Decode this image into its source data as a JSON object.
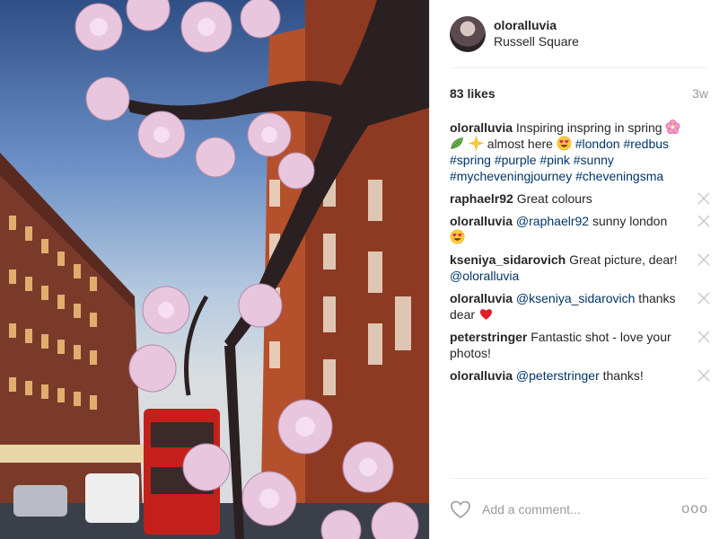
{
  "header": {
    "username": "oloralluvia",
    "location": "Russell Square"
  },
  "stats": {
    "likes": "83 likes",
    "time_ago": "3w"
  },
  "caption": {
    "author": "oloralluvia",
    "text1": " Inspiring inspring in spring ",
    "text2": " almost here ",
    "tags": [
      "#london",
      "#redbus",
      "#spring",
      "#purple",
      "#pink",
      "#sunny",
      "#mycheveningjourney",
      "#cheveningsma"
    ]
  },
  "comments": [
    {
      "author": "raphaelr92",
      "mention": "",
      "text": " Great colours"
    },
    {
      "author": "oloralluvia",
      "mention": "@raphaelr92",
      "text": " sunny london"
    },
    {
      "author": "kseniya_sidarovich",
      "mention": "",
      "text": " Great picture, dear! ",
      "trail_mention": "@oloralluvia"
    },
    {
      "author": "oloralluvia",
      "mention": "@kseniya_sidarovich",
      "text": " thanks dear "
    },
    {
      "author": "peterstringer",
      "mention": "",
      "text": " Fantastic shot - love your photos!"
    },
    {
      "author": "oloralluvia",
      "mention": "@peterstringer",
      "text": " thanks!"
    }
  ],
  "footer": {
    "add_comment_placeholder": "Add a comment...",
    "more_label": "ooo"
  },
  "icons": {
    "like": "heart-outline-icon",
    "delete": "close-x-icon",
    "more": "more-dots-icon"
  },
  "colors": {
    "link": "#003569",
    "muted": "#999999",
    "text": "#262626"
  }
}
